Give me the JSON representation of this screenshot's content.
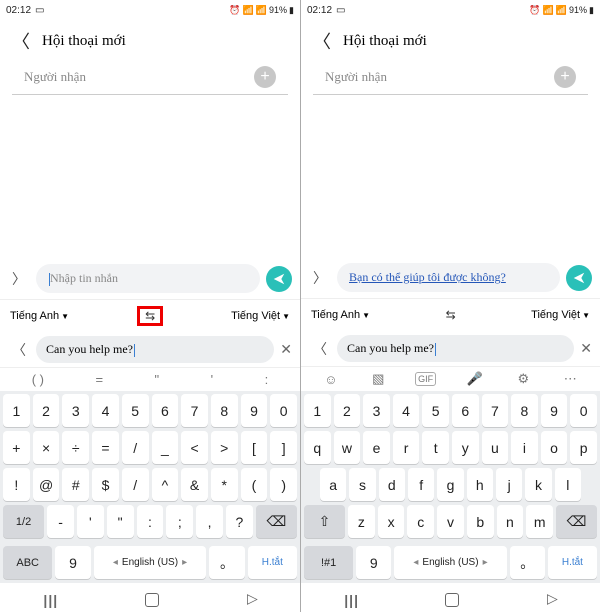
{
  "status": {
    "time": "02:12",
    "battery": "91%"
  },
  "header": {
    "title": "Hội thoại mới"
  },
  "recipient": {
    "placeholder": "Người nhận"
  },
  "compose_left": {
    "placeholder": "Nhập tin nhắn"
  },
  "compose_right": {
    "text": "Bạn có thể giúp tôi được không?"
  },
  "translate": {
    "lang_from": "Tiếng Anh",
    "lang_to": "Tiếng Việt",
    "input": "Can you help me?"
  },
  "toolbar_left": [
    "( )",
    "=",
    "\"",
    "'",
    ":"
  ],
  "keyboard_left": {
    "row1": [
      "1",
      "2",
      "3",
      "4",
      "5",
      "6",
      "7",
      "8",
      "9",
      "0"
    ],
    "row2": [
      "+",
      "×",
      "÷",
      "=",
      "/",
      "_",
      "<",
      ">",
      "[",
      "]"
    ],
    "row3": [
      "!",
      "@",
      "#",
      "$",
      "/",
      "^",
      "&",
      "*",
      "(",
      ")"
    ],
    "row4_mod_left": "1/2",
    "row4_keys": [
      "-",
      "'",
      "\"",
      ":",
      ";",
      ",",
      "?"
    ],
    "row5_mod_left": "ABC",
    "row5_comma": "9",
    "row5_space": "English (US)",
    "row5_dot": "。",
    "row5_enter": "H.tắt"
  },
  "keyboard_right": {
    "row1": [
      "1",
      "2",
      "3",
      "4",
      "5",
      "6",
      "7",
      "8",
      "9",
      "0"
    ],
    "row2": [
      "q",
      "w",
      "e",
      "r",
      "t",
      "y",
      "u",
      "i",
      "o",
      "p"
    ],
    "row3": [
      "a",
      "s",
      "d",
      "f",
      "g",
      "h",
      "j",
      "k",
      "l"
    ],
    "row4_keys": [
      "z",
      "x",
      "c",
      "v",
      "b",
      "n",
      "m"
    ],
    "row5_mod_left": "!#1",
    "row5_comma": "9",
    "row5_space": "English (US)",
    "row5_dot": "。",
    "row5_enter": "H.tắt"
  }
}
